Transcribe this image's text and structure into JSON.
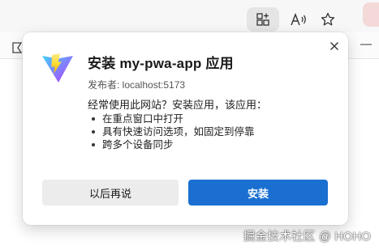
{
  "toolbar": {
    "icons": [
      "app-available-icon",
      "read-aloud-icon",
      "favorite-star-icon"
    ]
  },
  "dialog": {
    "title": "安装 my-pwa-app 应用",
    "publisher": "发布者: localhost:5173",
    "intro": "经常使用此网站？安装应用，该应用：",
    "features": [
      "在重点窗口中打开",
      "具有快速访问选项，如固定到停靠",
      "跨多个设备同步"
    ],
    "later_label": "以后再说",
    "install_label": "安装",
    "accent_color": "#1a6fd1"
  },
  "watermark": "掘金技术社区 @ HOHO"
}
